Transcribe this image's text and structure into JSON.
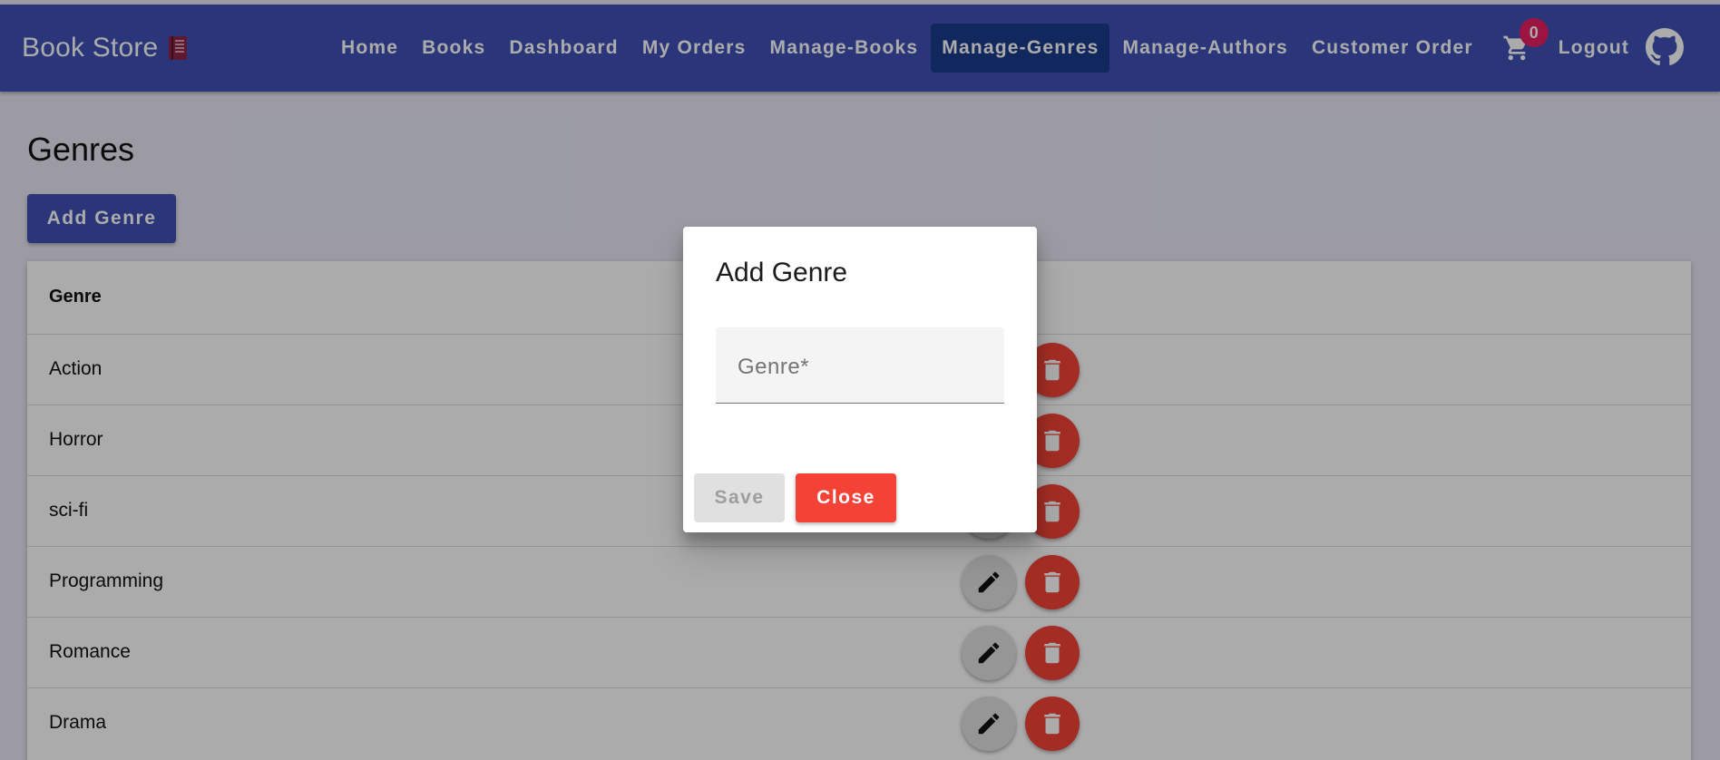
{
  "header": {
    "brand": "Book Store",
    "brand_icon": "book-icon",
    "nav": [
      {
        "label": "Home"
      },
      {
        "label": "Books"
      },
      {
        "label": "Dashboard"
      },
      {
        "label": "My Orders"
      },
      {
        "label": "Manage-Books"
      },
      {
        "label": "Manage-Genres",
        "active": true
      },
      {
        "label": "Manage-Authors"
      },
      {
        "label": "Customer Order"
      }
    ],
    "cart_icon": "shopping-cart-icon",
    "cart_count": "0",
    "logout": "Logout",
    "github_icon": "github-icon"
  },
  "page": {
    "title": "Genres",
    "add_button": "Add Genre"
  },
  "table": {
    "header": "Genre",
    "rows": [
      "Action",
      "Horror",
      "sci-fi",
      "Programming",
      "Romance",
      "Drama"
    ],
    "edit_icon": "pencil-icon",
    "delete_icon": "trash-icon"
  },
  "dialog": {
    "title": "Add Genre",
    "field_label": "Genre*",
    "field_value": "",
    "save": "Save",
    "close": "Close"
  },
  "colors": {
    "appbar": "#3f51b5",
    "active_nav": "#1a3c8c",
    "badge": "#e91e63",
    "danger": "#f44336"
  }
}
